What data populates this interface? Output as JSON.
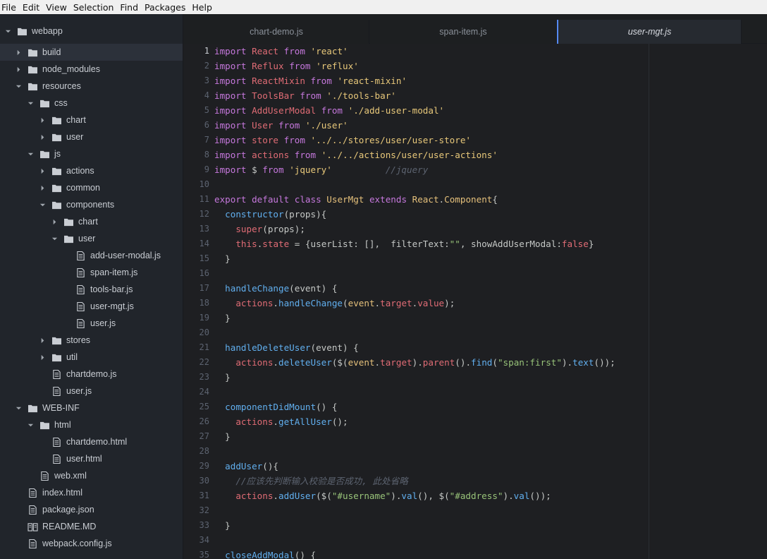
{
  "menubar": {
    "items": [
      "File",
      "Edit",
      "View",
      "Selection",
      "Find",
      "Packages",
      "Help"
    ]
  },
  "tree": {
    "root": "webapp",
    "rows": [
      {
        "label": "build",
        "type": "folder",
        "depth": 1,
        "expanded": false,
        "selected": true
      },
      {
        "label": "node_modules",
        "type": "folder",
        "depth": 1,
        "expanded": false
      },
      {
        "label": "resources",
        "type": "folder",
        "depth": 1,
        "expanded": true
      },
      {
        "label": "css",
        "type": "folder",
        "depth": 2,
        "expanded": true
      },
      {
        "label": "chart",
        "type": "folder",
        "depth": 3,
        "expanded": false
      },
      {
        "label": "user",
        "type": "folder",
        "depth": 3,
        "expanded": false
      },
      {
        "label": "js",
        "type": "folder",
        "depth": 2,
        "expanded": true
      },
      {
        "label": "actions",
        "type": "folder",
        "depth": 3,
        "expanded": false
      },
      {
        "label": "common",
        "type": "folder",
        "depth": 3,
        "expanded": false
      },
      {
        "label": "components",
        "type": "folder",
        "depth": 3,
        "expanded": true
      },
      {
        "label": "chart",
        "type": "folder",
        "depth": 4,
        "expanded": false
      },
      {
        "label": "user",
        "type": "folder",
        "depth": 4,
        "expanded": true
      },
      {
        "label": "add-user-modal.js",
        "type": "file",
        "depth": 5
      },
      {
        "label": "span-item.js",
        "type": "file",
        "depth": 5
      },
      {
        "label": "tools-bar.js",
        "type": "file",
        "depth": 5
      },
      {
        "label": "user-mgt.js",
        "type": "file",
        "depth": 5
      },
      {
        "label": "user.js",
        "type": "file",
        "depth": 5
      },
      {
        "label": "stores",
        "type": "folder",
        "depth": 3,
        "expanded": false
      },
      {
        "label": "util",
        "type": "folder",
        "depth": 3,
        "expanded": false
      },
      {
        "label": "chartdemo.js",
        "type": "file",
        "depth": 3
      },
      {
        "label": "user.js",
        "type": "file",
        "depth": 3
      },
      {
        "label": "WEB-INF",
        "type": "folder",
        "depth": 1,
        "expanded": true
      },
      {
        "label": "html",
        "type": "folder",
        "depth": 2,
        "expanded": true
      },
      {
        "label": "chartdemo.html",
        "type": "file",
        "depth": 3
      },
      {
        "label": "user.html",
        "type": "file",
        "depth": 3
      },
      {
        "label": "web.xml",
        "type": "file",
        "depth": 2
      },
      {
        "label": "index.html",
        "type": "file",
        "depth": 1
      },
      {
        "label": "package.json",
        "type": "file",
        "depth": 1
      },
      {
        "label": "README.MD",
        "type": "book",
        "depth": 1
      },
      {
        "label": "webpack.config.js",
        "type": "file",
        "depth": 1
      }
    ]
  },
  "tabs": [
    {
      "label": "chart-demo.js",
      "active": false
    },
    {
      "label": "span-item.js",
      "active": false
    },
    {
      "label": "user-mgt.js",
      "active": true
    }
  ],
  "editor": {
    "current_line": 1,
    "lines": [
      {
        "n": "1",
        "tokens": [
          [
            "kw",
            "import"
          ],
          [
            "plain",
            " "
          ],
          [
            "cls",
            "React"
          ],
          [
            "plain",
            " "
          ],
          [
            "kw",
            "from"
          ],
          [
            "plain",
            " "
          ],
          [
            "str",
            "'react'"
          ]
        ]
      },
      {
        "n": "2",
        "tokens": [
          [
            "kw",
            "import"
          ],
          [
            "plain",
            " "
          ],
          [
            "cls",
            "Reflux"
          ],
          [
            "plain",
            " "
          ],
          [
            "kw",
            "from"
          ],
          [
            "plain",
            " "
          ],
          [
            "str",
            "'reflux'"
          ]
        ]
      },
      {
        "n": "3",
        "tokens": [
          [
            "kw",
            "import"
          ],
          [
            "plain",
            " "
          ],
          [
            "cls",
            "ReactMixin"
          ],
          [
            "plain",
            " "
          ],
          [
            "kw",
            "from"
          ],
          [
            "plain",
            " "
          ],
          [
            "str",
            "'react-mixin'"
          ]
        ]
      },
      {
        "n": "4",
        "tokens": [
          [
            "kw",
            "import"
          ],
          [
            "plain",
            " "
          ],
          [
            "cls",
            "ToolsBar"
          ],
          [
            "plain",
            " "
          ],
          [
            "kw",
            "from"
          ],
          [
            "plain",
            " "
          ],
          [
            "str",
            "'./tools-bar'"
          ]
        ]
      },
      {
        "n": "5",
        "tokens": [
          [
            "kw",
            "import"
          ],
          [
            "plain",
            " "
          ],
          [
            "cls",
            "AddUserModal"
          ],
          [
            "plain",
            " "
          ],
          [
            "kw",
            "from"
          ],
          [
            "plain",
            " "
          ],
          [
            "str",
            "'./add-user-modal'"
          ]
        ]
      },
      {
        "n": "6",
        "tokens": [
          [
            "kw",
            "import"
          ],
          [
            "plain",
            " "
          ],
          [
            "cls",
            "User"
          ],
          [
            "plain",
            " "
          ],
          [
            "kw",
            "from"
          ],
          [
            "plain",
            " "
          ],
          [
            "str",
            "'./user'"
          ]
        ]
      },
      {
        "n": "7",
        "tokens": [
          [
            "kw",
            "import"
          ],
          [
            "plain",
            " "
          ],
          [
            "cls",
            "store"
          ],
          [
            "plain",
            " "
          ],
          [
            "kw",
            "from"
          ],
          [
            "plain",
            " "
          ],
          [
            "str",
            "'../../stores/user/user-store'"
          ]
        ]
      },
      {
        "n": "8",
        "tokens": [
          [
            "kw",
            "import"
          ],
          [
            "plain",
            " "
          ],
          [
            "cls",
            "actions"
          ],
          [
            "plain",
            " "
          ],
          [
            "kw",
            "from"
          ],
          [
            "plain",
            " "
          ],
          [
            "str",
            "'../../actions/user/user-actions'"
          ]
        ]
      },
      {
        "n": "9",
        "tokens": [
          [
            "kw",
            "import"
          ],
          [
            "plain",
            " $ "
          ],
          [
            "kw",
            "from"
          ],
          [
            "plain",
            " "
          ],
          [
            "str",
            "'jquery'"
          ],
          [
            "plain",
            "          "
          ],
          [
            "cmt",
            "//jquery"
          ]
        ]
      },
      {
        "n": "10",
        "tokens": []
      },
      {
        "n": "11",
        "tokens": [
          [
            "kw",
            "export"
          ],
          [
            "plain",
            " "
          ],
          [
            "kw",
            "default"
          ],
          [
            "plain",
            " "
          ],
          [
            "kw",
            "class"
          ],
          [
            "plain",
            " "
          ],
          [
            "def",
            "UserMgt"
          ],
          [
            "plain",
            " "
          ],
          [
            "kw",
            "extends"
          ],
          [
            "plain",
            " "
          ],
          [
            "def",
            "React"
          ],
          [
            "plain",
            "."
          ],
          [
            "def",
            "Component"
          ],
          [
            "plain",
            "{"
          ]
        ]
      },
      {
        "n": "12",
        "tokens": [
          [
            "plain",
            "  "
          ],
          [
            "fn",
            "constructor"
          ],
          [
            "plain",
            "(props){"
          ]
        ]
      },
      {
        "n": "13",
        "tokens": [
          [
            "plain",
            "    "
          ],
          [
            "cls",
            "super"
          ],
          [
            "plain",
            "(props);"
          ]
        ]
      },
      {
        "n": "14",
        "tokens": [
          [
            "plain",
            "    "
          ],
          [
            "cls",
            "this"
          ],
          [
            "plain",
            "."
          ],
          [
            "prop",
            "state"
          ],
          [
            "plain",
            " = {userList: [],  filterText:"
          ],
          [
            "dstr",
            "\"\""
          ],
          [
            "plain",
            ", showAddUserModal:"
          ],
          [
            "cls",
            "false"
          ],
          [
            "plain",
            "}"
          ]
        ]
      },
      {
        "n": "15",
        "tokens": [
          [
            "plain",
            "  }"
          ]
        ]
      },
      {
        "n": "16",
        "tokens": []
      },
      {
        "n": "17",
        "tokens": [
          [
            "plain",
            "  "
          ],
          [
            "fn",
            "handleChange"
          ],
          [
            "plain",
            "(event) {"
          ]
        ]
      },
      {
        "n": "18",
        "tokens": [
          [
            "plain",
            "    "
          ],
          [
            "cls",
            "actions"
          ],
          [
            "plain",
            "."
          ],
          [
            "fn",
            "handleChange"
          ],
          [
            "plain",
            "("
          ],
          [
            "var",
            "event"
          ],
          [
            "plain",
            "."
          ],
          [
            "prop",
            "target"
          ],
          [
            "plain",
            "."
          ],
          [
            "prop",
            "value"
          ],
          [
            "plain",
            ");"
          ]
        ]
      },
      {
        "n": "19",
        "tokens": [
          [
            "plain",
            "  }"
          ]
        ]
      },
      {
        "n": "20",
        "tokens": []
      },
      {
        "n": "21",
        "tokens": [
          [
            "plain",
            "  "
          ],
          [
            "fn",
            "handleDeleteUser"
          ],
          [
            "plain",
            "(event) {"
          ]
        ]
      },
      {
        "n": "22",
        "tokens": [
          [
            "plain",
            "    "
          ],
          [
            "cls",
            "actions"
          ],
          [
            "plain",
            "."
          ],
          [
            "fn",
            "deleteUser"
          ],
          [
            "plain",
            "($("
          ],
          [
            "var",
            "event"
          ],
          [
            "plain",
            "."
          ],
          [
            "prop",
            "target"
          ],
          [
            "plain",
            ")."
          ],
          [
            "cls",
            "parent"
          ],
          [
            "plain",
            "()."
          ],
          [
            "fn",
            "find"
          ],
          [
            "plain",
            "("
          ],
          [
            "dstr",
            "\"span:first\""
          ],
          [
            "plain",
            ")."
          ],
          [
            "fn",
            "text"
          ],
          [
            "plain",
            "());"
          ]
        ]
      },
      {
        "n": "23",
        "tokens": [
          [
            "plain",
            "  }"
          ]
        ]
      },
      {
        "n": "24",
        "tokens": []
      },
      {
        "n": "25",
        "tokens": [
          [
            "plain",
            "  "
          ],
          [
            "fn",
            "componentDidMount"
          ],
          [
            "plain",
            "() {"
          ]
        ]
      },
      {
        "n": "26",
        "tokens": [
          [
            "plain",
            "    "
          ],
          [
            "cls",
            "actions"
          ],
          [
            "plain",
            "."
          ],
          [
            "fn",
            "getAllUser"
          ],
          [
            "plain",
            "();"
          ]
        ]
      },
      {
        "n": "27",
        "tokens": [
          [
            "plain",
            "  }"
          ]
        ]
      },
      {
        "n": "28",
        "tokens": []
      },
      {
        "n": "29",
        "tokens": [
          [
            "plain",
            "  "
          ],
          [
            "fn",
            "addUser"
          ],
          [
            "plain",
            "(){"
          ]
        ]
      },
      {
        "n": "30",
        "tokens": [
          [
            "plain",
            "    "
          ],
          [
            "cmt",
            "//应该先判断输入校验是否成功, 此处省略"
          ]
        ]
      },
      {
        "n": "31",
        "tokens": [
          [
            "plain",
            "    "
          ],
          [
            "cls",
            "actions"
          ],
          [
            "plain",
            "."
          ],
          [
            "fn",
            "addUser"
          ],
          [
            "plain",
            "($("
          ],
          [
            "dstr",
            "\"#username\""
          ],
          [
            "plain",
            ")."
          ],
          [
            "fn",
            "val"
          ],
          [
            "plain",
            "(), $("
          ],
          [
            "dstr",
            "\"#address\""
          ],
          [
            "plain",
            ")."
          ],
          [
            "fn",
            "val"
          ],
          [
            "plain",
            "());"
          ]
        ]
      },
      {
        "n": "32",
        "tokens": []
      },
      {
        "n": "33",
        "tokens": [
          [
            "plain",
            "  }"
          ]
        ]
      },
      {
        "n": "34",
        "tokens": []
      },
      {
        "n": "35",
        "tokens": [
          [
            "plain",
            "  "
          ],
          [
            "fn",
            "closeAddModal"
          ],
          [
            "plain",
            "() {"
          ]
        ]
      }
    ]
  }
}
